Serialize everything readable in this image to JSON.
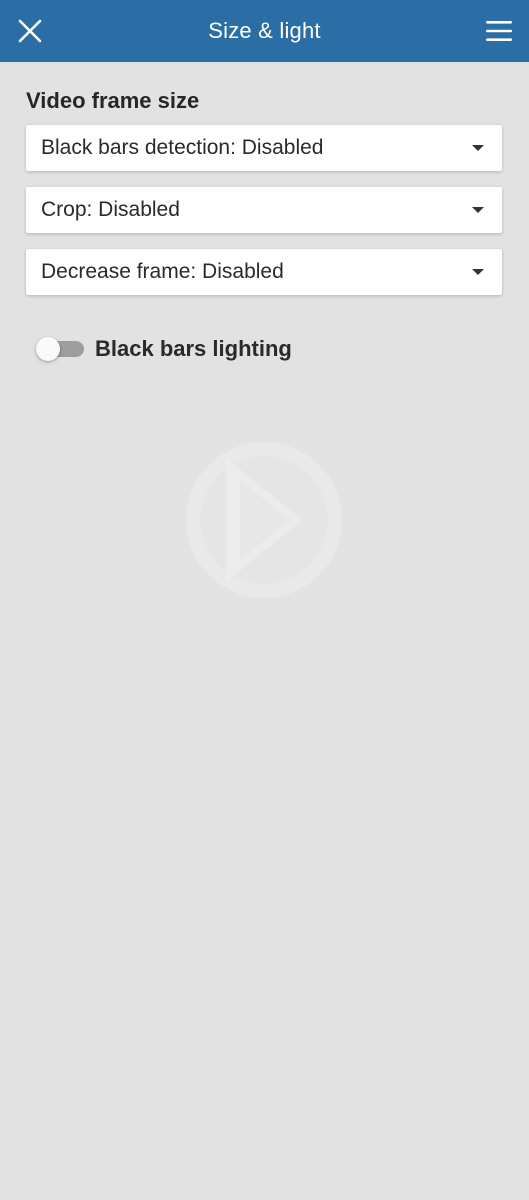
{
  "header": {
    "title": "Size & light",
    "close_icon": "close-icon",
    "menu_icon": "hamburger-menu-icon",
    "background_color": "#2a6ea5"
  },
  "video_frame_size": {
    "title": "Video frame size",
    "dropdowns": [
      {
        "label": "Black bars detection: Disabled"
      },
      {
        "label": "Crop: Disabled"
      },
      {
        "label": "Decrease frame: Disabled"
      }
    ]
  },
  "black_bars_lighting": {
    "label": "Black bars lighting",
    "enabled": false
  },
  "watermark_icon": "play-logo-icon"
}
